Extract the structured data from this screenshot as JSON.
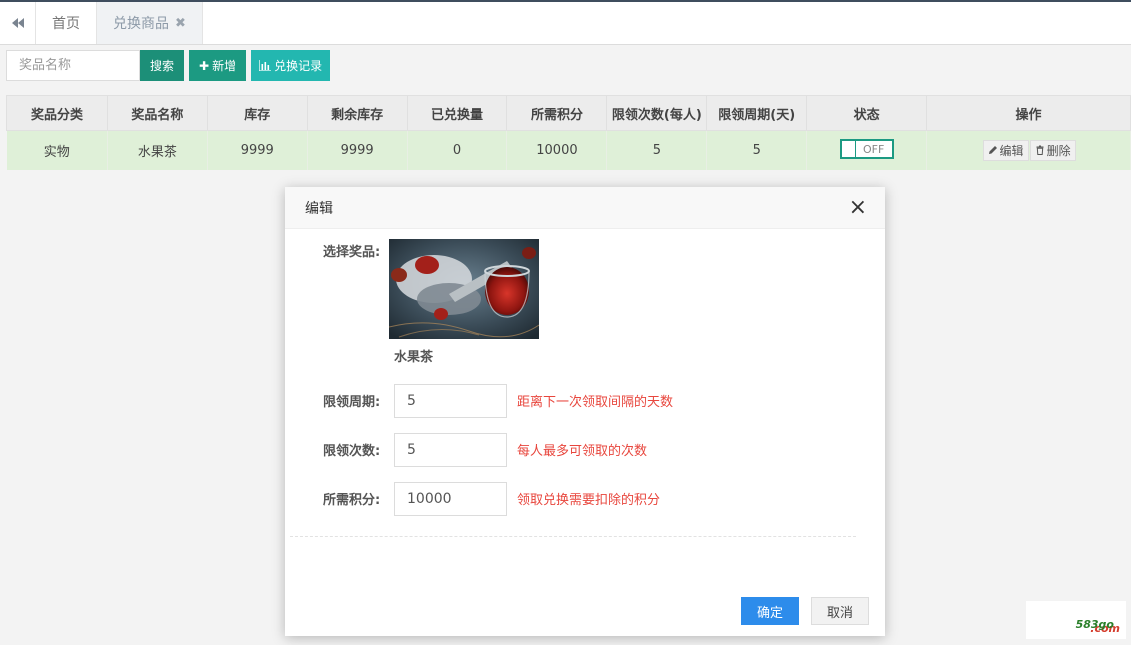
{
  "tabs": {
    "back_icon": "double-chevron-left-icon",
    "home": "首页",
    "current": "兑换商品",
    "close_glyph": "✖"
  },
  "toolbar": {
    "search_placeholder": "奖品名称",
    "search_label": "搜索",
    "add_label": "新增",
    "add_glyph": "✚",
    "records_label": "兑换记录",
    "records_icon": "bar-chart-icon"
  },
  "table": {
    "headers": [
      "奖品分类",
      "奖品名称",
      "库存",
      "剩余库存",
      "已兑换量",
      "所需积分",
      "限领次数(每人)",
      "限领周期(天)",
      "状态",
      "操作"
    ],
    "rows": [
      {
        "category": "实物",
        "name": "水果茶",
        "stock": "9999",
        "remaining": "9999",
        "redeemed": "0",
        "points": "10000",
        "limit_count": "5",
        "limit_period": "5",
        "status": "OFF",
        "edit_label": "编辑",
        "delete_label": "删除"
      }
    ]
  },
  "modal": {
    "title": "编辑",
    "close_glyph": "×",
    "prize_label": "选择奖品:",
    "prize_name": "水果茶",
    "period_label": "限领周期:",
    "period_value": "5",
    "period_hint": "距离下一次领取间隔的天数",
    "count_label": "限领次数:",
    "count_value": "5",
    "count_hint": "每人最多可领取的次数",
    "points_label": "所需积分:",
    "points_value": "10000",
    "points_hint": "领取兑换需要扣除的积分",
    "ok_label": "确定",
    "cancel_label": "取消"
  },
  "watermark": {
    "prefix": "583go",
    "suffix": ".com"
  },
  "colors": {
    "teal": "#1c9a82",
    "cyan": "#23b7b0",
    "row_highlight": "#dff0d8",
    "primary": "#2d8ceb",
    "hint_red": "#e8463d"
  }
}
